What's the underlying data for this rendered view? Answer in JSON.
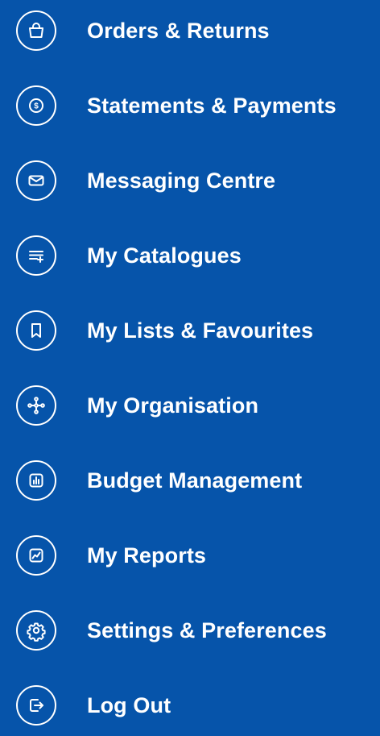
{
  "menu": {
    "items": [
      {
        "label": "Orders & Returns",
        "icon": "shopping-bag-icon"
      },
      {
        "label": "Statements & Payments",
        "icon": "dollar-coin-icon"
      },
      {
        "label": "Messaging Centre",
        "icon": "envelope-icon"
      },
      {
        "label": "My Catalogues",
        "icon": "list-add-icon"
      },
      {
        "label": "My Lists & Favourites",
        "icon": "bookmark-icon"
      },
      {
        "label": "My Organisation",
        "icon": "org-tree-icon"
      },
      {
        "label": "Budget Management",
        "icon": "bar-chart-icon"
      },
      {
        "label": "My Reports",
        "icon": "trend-chart-icon"
      },
      {
        "label": "Settings & Preferences",
        "icon": "gear-icon"
      },
      {
        "label": "Log Out",
        "icon": "logout-icon"
      }
    ]
  },
  "colors": {
    "background": "#0654AA",
    "foreground": "#FFFFFF"
  }
}
